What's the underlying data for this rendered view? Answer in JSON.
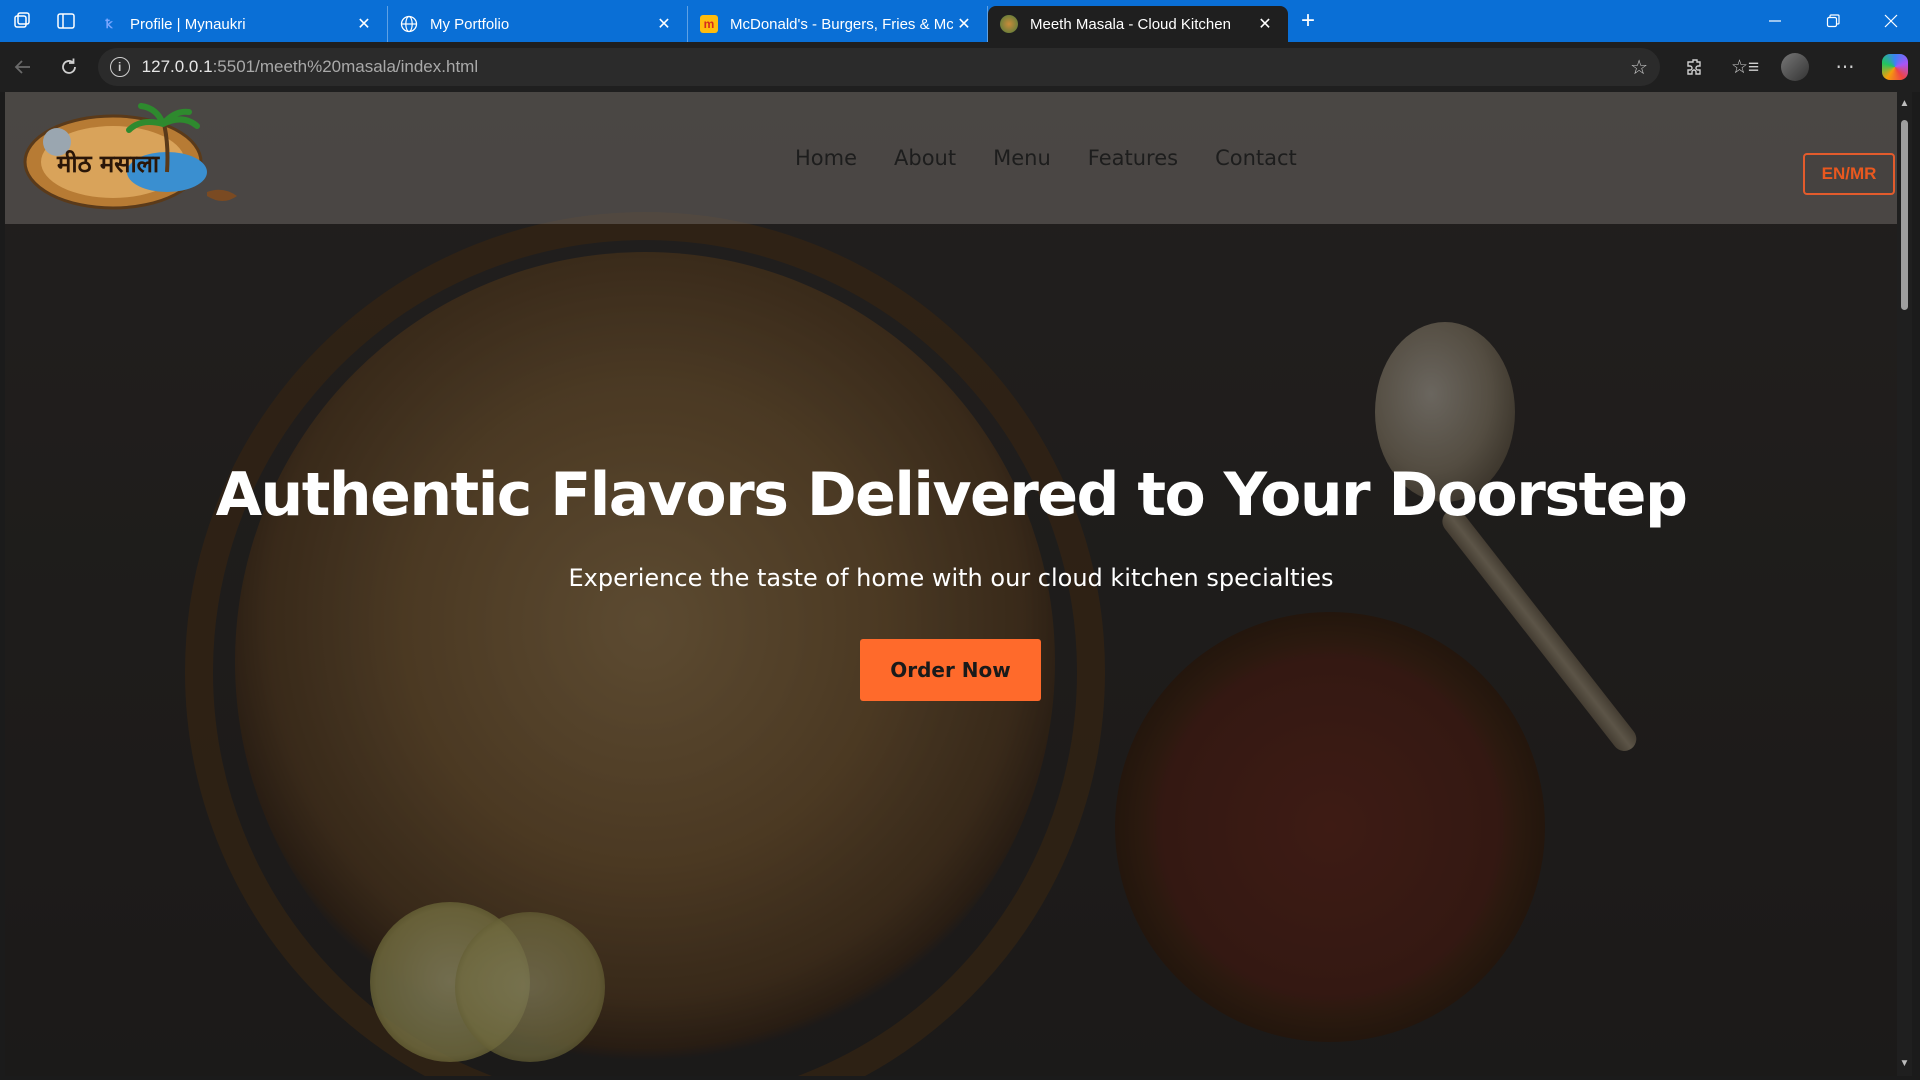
{
  "browser": {
    "tabs": [
      {
        "title": "Profile | Mynaukri",
        "icon": "mynaukri-favicon",
        "active": false
      },
      {
        "title": "My Portfolio",
        "icon": "globe-icon",
        "active": false
      },
      {
        "title": "McDonald's - Burgers, Fries & Mc",
        "icon": "mcdonalds-favicon",
        "active": false
      },
      {
        "title": "Meeth Masala - Cloud Kitchen",
        "icon": "meeth-masala-favicon",
        "active": true
      }
    ],
    "address": {
      "host": "127.0.0.1",
      "path": ":5501/meeth%20masala/index.html"
    },
    "new_tab_glyph": "+",
    "close_glyph": "✕"
  },
  "site": {
    "logo_text": "मीठ मसाला",
    "nav": [
      "Home",
      "About",
      "Menu",
      "Features",
      "Contact"
    ],
    "language_toggle": "EN/MR",
    "hero": {
      "title": "Authentic Flavors Delivered to Your Doorstep",
      "subtitle": "Experience the taste of home with our cloud kitchen specialties",
      "cta": "Order Now"
    }
  },
  "colors": {
    "browser_accent": "#0a6fd6",
    "cta": "#ff6a2b",
    "lang_border": "#e35b2c"
  }
}
